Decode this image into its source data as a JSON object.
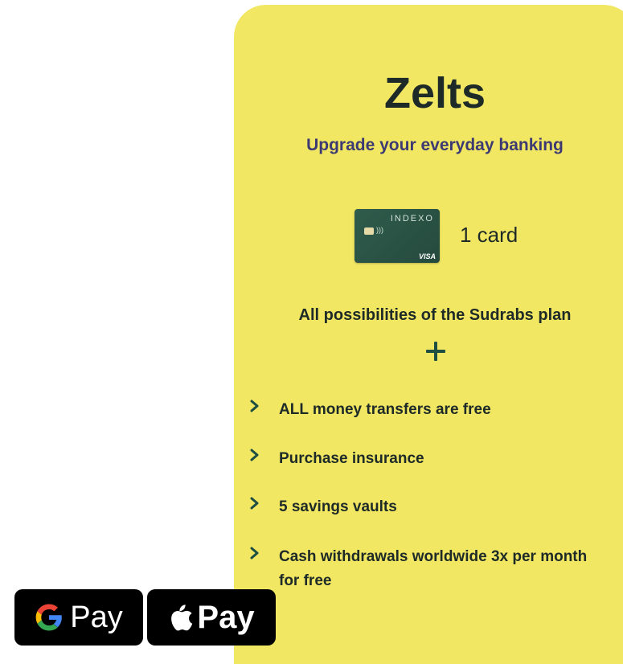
{
  "plan": {
    "title": "Zelts",
    "subtitle": "Upgrade your everyday banking",
    "card": {
      "brand": "INDEXO",
      "network": "VISA",
      "count_label": "1 card"
    },
    "includes_label": "All possibilities of the Sudrabs plan",
    "features": [
      "ALL money transfers are free",
      "Purchase insurance",
      "5 savings vaults",
      "Cash withdrawals worldwide 3x per month for free"
    ]
  },
  "payment_buttons": [
    {
      "icon": "google-g-icon",
      "label": "Pay"
    },
    {
      "icon": "apple-icon",
      "label": "Pay"
    }
  ],
  "colors": {
    "card_background": "#f1e763",
    "title_text": "#1e2a27",
    "subtitle_text": "#3d3a73",
    "accent_green": "#1f4f43",
    "pay_button": "#000000"
  }
}
